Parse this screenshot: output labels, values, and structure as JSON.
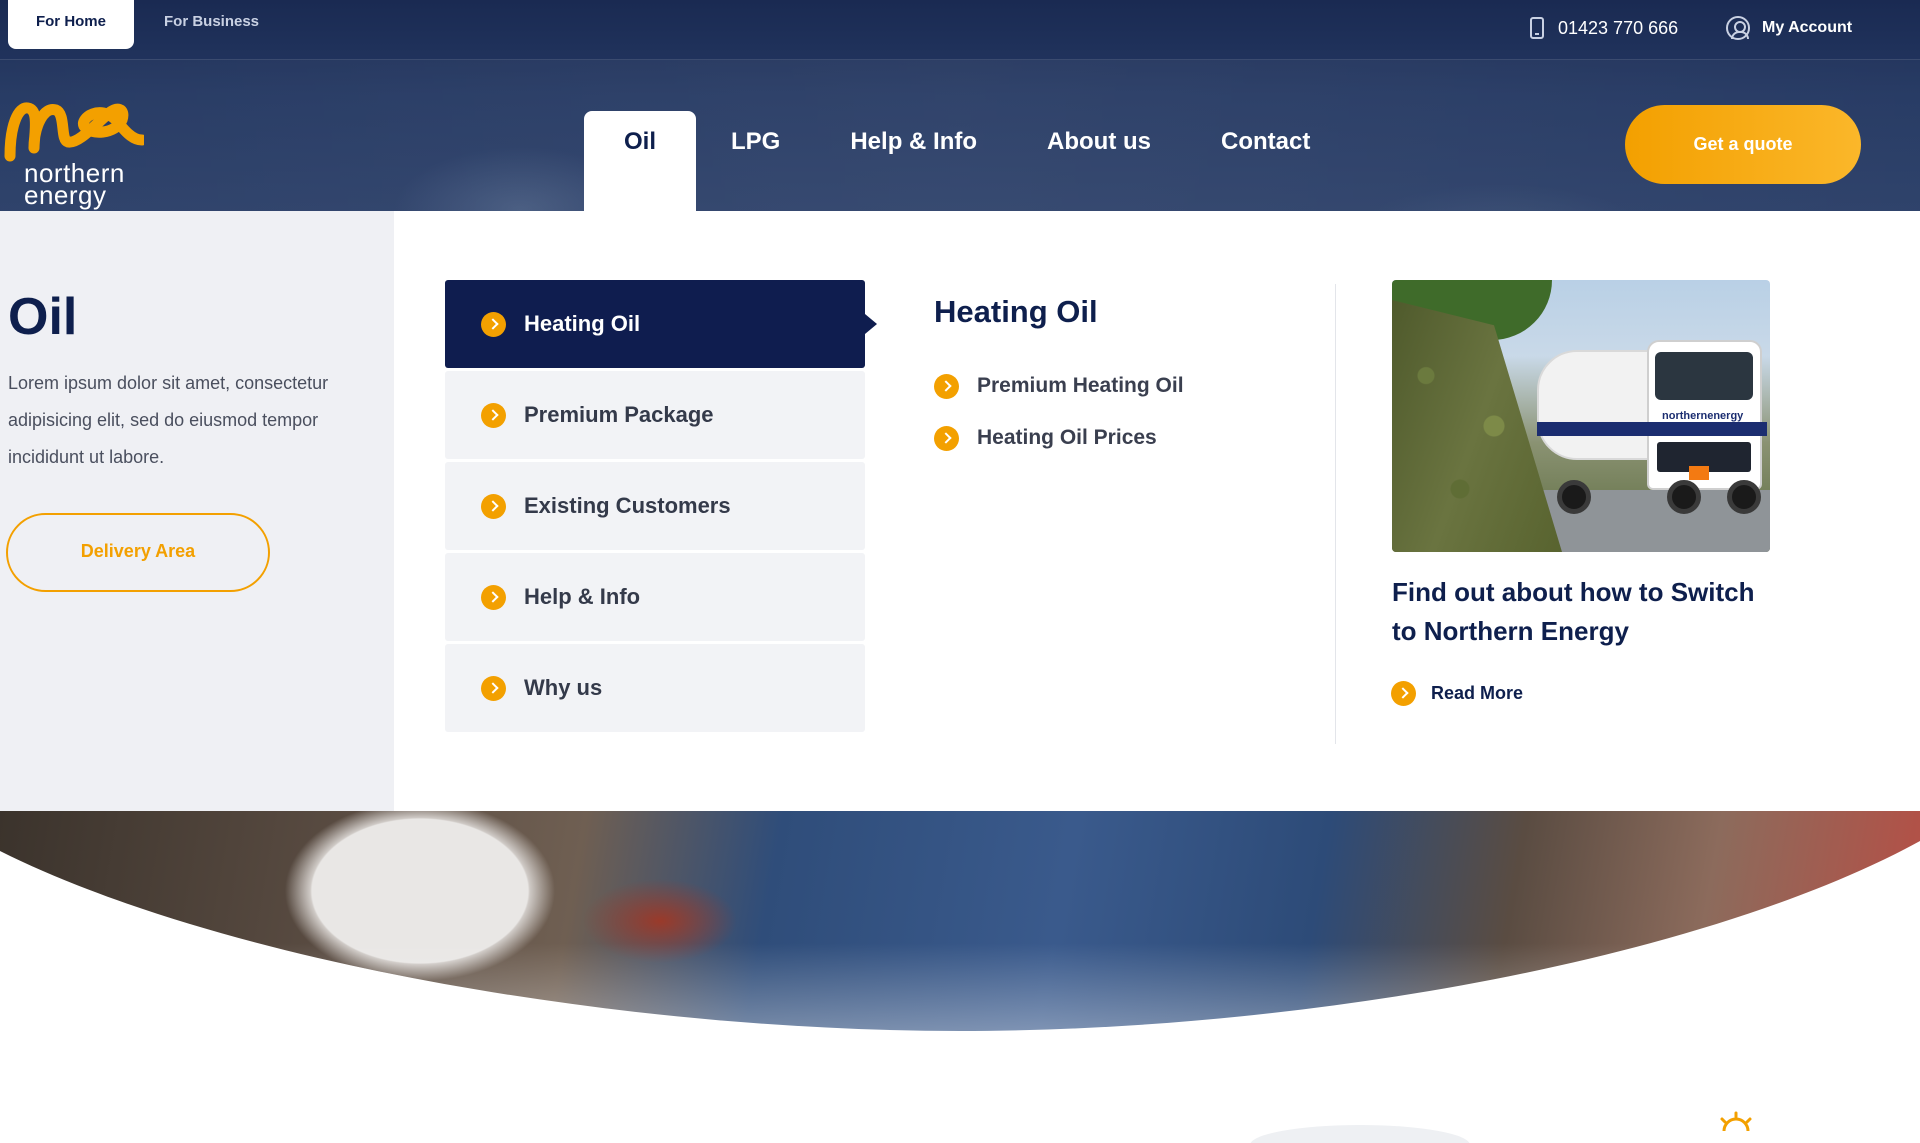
{
  "topbar": {
    "segments": [
      "For Home",
      "For Business"
    ],
    "phone": "01423 770 666",
    "account_label": "My Account"
  },
  "logo": {
    "line1": "northern",
    "line2": "energy"
  },
  "nav": {
    "items": [
      "Oil",
      "LPG",
      "Help & Info",
      "About us",
      "Contact"
    ],
    "active": "Oil",
    "cta": "Get a quote"
  },
  "panel": {
    "title": "Oil",
    "description": "Lorem ipsum dolor sit amet, consectetur adipisicing elit, sed do eiusmod tempor incididunt ut labore.",
    "delivery_button": "Delivery Area",
    "categories": [
      "Heating Oil",
      "Premium Package",
      "Existing Customers",
      "Help & Info",
      "Why us"
    ],
    "active_category": "Heating Oil",
    "subsection": {
      "title": "Heating Oil",
      "links": [
        "Premium Heating Oil",
        "Heating Oil Prices"
      ]
    },
    "promo": {
      "title": "Find out about how to Switch to Northern Energy",
      "link": "Read More",
      "image_brand": "northernenergy"
    }
  },
  "colors": {
    "navy": "#0e1f4d",
    "accent_orange": "#f3a000",
    "panel_grey": "#eff0f4"
  },
  "icons": [
    "phone-icon",
    "account-icon",
    "chevron-right-icon"
  ]
}
